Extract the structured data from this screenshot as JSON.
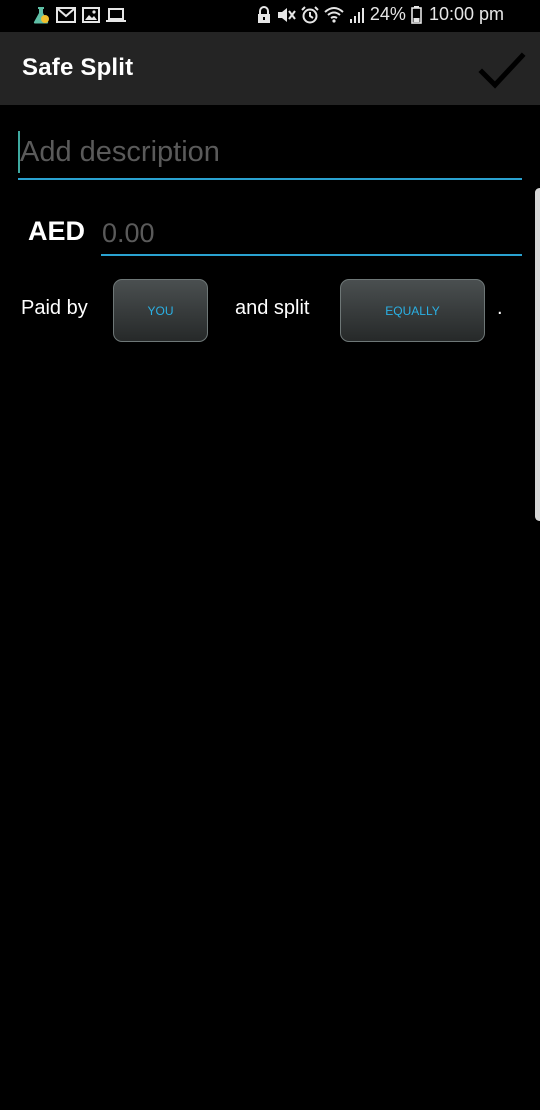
{
  "status_bar": {
    "left_icons": [
      "flask-icon",
      "mail-icon",
      "image-icon",
      "laptop-icon"
    ],
    "right_icons": [
      "lock-icon",
      "mute-icon",
      "alarm-icon",
      "wifi-icon",
      "signal-icon",
      "battery-icon"
    ],
    "battery_percent": "24%",
    "time": "10:00 pm"
  },
  "app_bar": {
    "title": "Safe Split",
    "confirm_icon": "checkmark-icon"
  },
  "form": {
    "description": {
      "value": "",
      "placeholder": "Add description"
    },
    "amount": {
      "currency": "AED",
      "value": "",
      "placeholder": "0.00"
    },
    "paid_by_label": "Paid by",
    "paid_by_value": "YOU",
    "split_label": "and split",
    "split_value": "EQUALLY",
    "end_punct": "."
  },
  "colors": {
    "accent": "#2aa2d0",
    "button_text": "#2ab0e4",
    "app_bar_bg": "#242424",
    "background": "#000000"
  }
}
